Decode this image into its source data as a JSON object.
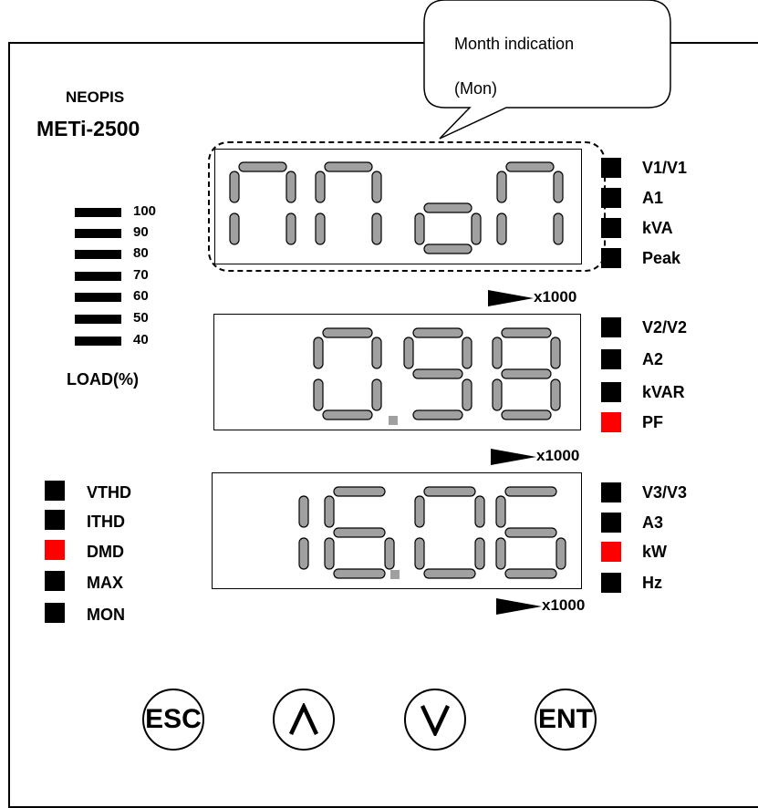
{
  "brand": {
    "maker": "NEOPIS",
    "model": "METi-2500"
  },
  "callout": {
    "line1": "Month indication",
    "line2": "(Mon)"
  },
  "displays": [
    {
      "id": "top",
      "digits": [
        "n",
        "n",
        "o",
        "n"
      ],
      "decimal_point": false
    },
    {
      "id": "middle",
      "digits": [
        " ",
        "0",
        "9",
        "8"
      ],
      "decimal_point": true
    },
    {
      "id": "bottom",
      "digits": [
        " ",
        "1",
        "6",
        "0",
        "6"
      ],
      "decimal_point": true
    }
  ],
  "multiplier_label": "x1000",
  "load": {
    "title": "LOAD(%)",
    "levels": [
      "100",
      "90",
      "80",
      "70",
      "60",
      "50",
      "40"
    ]
  },
  "right_indicators": [
    {
      "label": "V1/V1",
      "active": false
    },
    {
      "label": "A1",
      "active": false
    },
    {
      "label": "kVA",
      "active": false
    },
    {
      "label": "Peak",
      "active": false
    },
    {
      "label": "V2/V2",
      "active": false
    },
    {
      "label": "A2",
      "active": false
    },
    {
      "label": "kVAR",
      "active": false
    },
    {
      "label": "PF",
      "active": true
    },
    {
      "label": "V3/V3",
      "active": false
    },
    {
      "label": "A3",
      "active": false
    },
    {
      "label": "kW",
      "active": true
    },
    {
      "label": "Hz",
      "active": false
    }
  ],
  "left_indicators": [
    {
      "label": "VTHD",
      "active": false
    },
    {
      "label": "ITHD",
      "active": false
    },
    {
      "label": "DMD",
      "active": true
    },
    {
      "label": "MAX",
      "active": false
    },
    {
      "label": "MON",
      "active": false
    }
  ],
  "buttons": [
    {
      "name": "esc-button",
      "label": "ESC",
      "icon": "text"
    },
    {
      "name": "up-button",
      "label": "",
      "icon": "caret-up-icon"
    },
    {
      "name": "down-button",
      "label": "",
      "icon": "caret-down-icon"
    },
    {
      "name": "ent-button",
      "label": "ENT",
      "icon": "text"
    }
  ],
  "colors": {
    "segment_on": "#a0a0a0",
    "segment_outline": "#000000",
    "indicator_off": "#000000",
    "indicator_on": "#ff0000",
    "decimal_point": "#a0a0a0"
  }
}
